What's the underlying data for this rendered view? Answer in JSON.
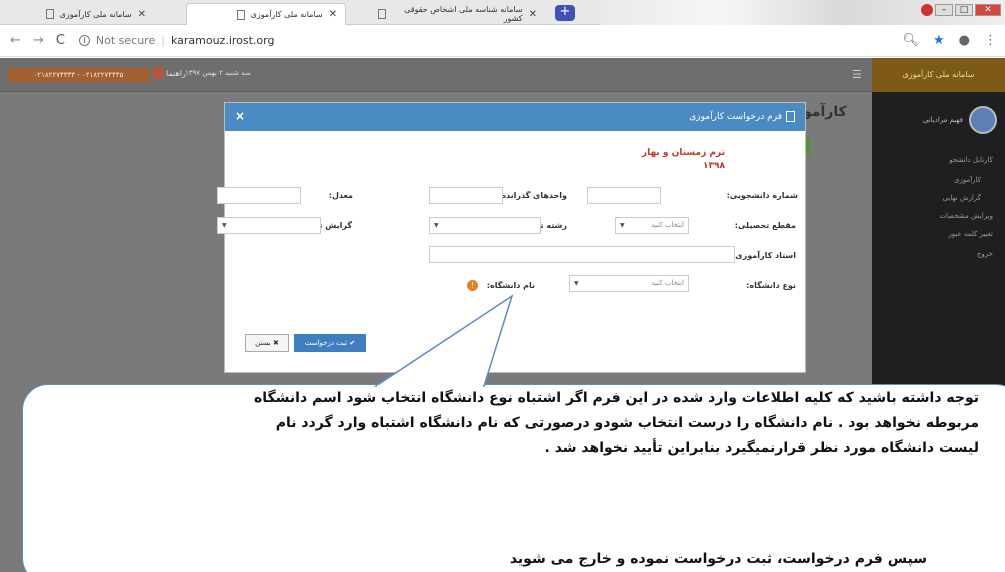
{
  "browser": {
    "tabs": [
      {
        "label": "سامانه ملی کارآموزی"
      },
      {
        "label": "سامانه ملی کارآموزی"
      },
      {
        "label": "سامانه شناسه ملی اشخاص حقوقی کشور"
      }
    ],
    "new_tab": "+",
    "url_security": "Not secure",
    "url": "karamouz.irost.org",
    "win_min": "–",
    "win_max": "□",
    "win_close": "✕"
  },
  "topbar": {
    "orange_button": "۰۲۱۸۲۲۷۴۳۳۳ - ۰۲۱۸۲۲۷۴۴۳۵",
    "help": "راهنما",
    "date": "سه شنبه ۲ بهمن ۱۳۹۷"
  },
  "sidebar": {
    "header": "سامانه ملی کارآموزی",
    "user_name": "فهیم مرادیانی",
    "items": [
      "کارتابل دانشجو",
      "کارآموزی",
      "گزارش نهایی",
      "ویرایش مشخصات",
      "تغییر کلمه عبور",
      "خروج"
    ]
  },
  "page_title": "کارآموز",
  "modal": {
    "title": "فرم درخواست کارآموزی",
    "close": "×",
    "term_line1": "ترم زمستان و بهار",
    "term_line2": "۱۳۹۸",
    "fields": {
      "student_number_label": "شماره دانشجویی:",
      "units_label": "واحدهای گذرانده:",
      "gpa_label": "معدل:",
      "degree_label": "مقطع تحصیلی:",
      "degree_value": "انتخاب کنید",
      "major_label": "رشته تحصیلی:",
      "orientation_label": "گرایش تحصیلی:",
      "supervisor_label": "استاد کارآموزی:",
      "uni_type_label": "نوع دانشگاه:",
      "uni_type_value": "انتخاب کنید",
      "uni_name_label": "نام دانشگاه:"
    },
    "submit": "✔ ثبت درخواست",
    "close_button": "✖ بستن"
  },
  "callout": {
    "lines": [
      "توجه داشته باشید که کلیه اطلاعات وارد شده در این فرم اگر اشتباه  نوع دانشگاه انتخاب شود اسم دانشگاه",
      "مربوطه نخواهد بود .   نام دانشگاه را درست انتخاب شودو درصورتی که نام دانشگاه اشتباه وارد گردد نام",
      "لیست دانشگاه مورد نظر قرارنمیگیرد بنابراین تأیید نخواهد شد ."
    ],
    "last_line": "سپس فرم درخواست، ثبت درخواست نموده و خارج می شوید"
  }
}
